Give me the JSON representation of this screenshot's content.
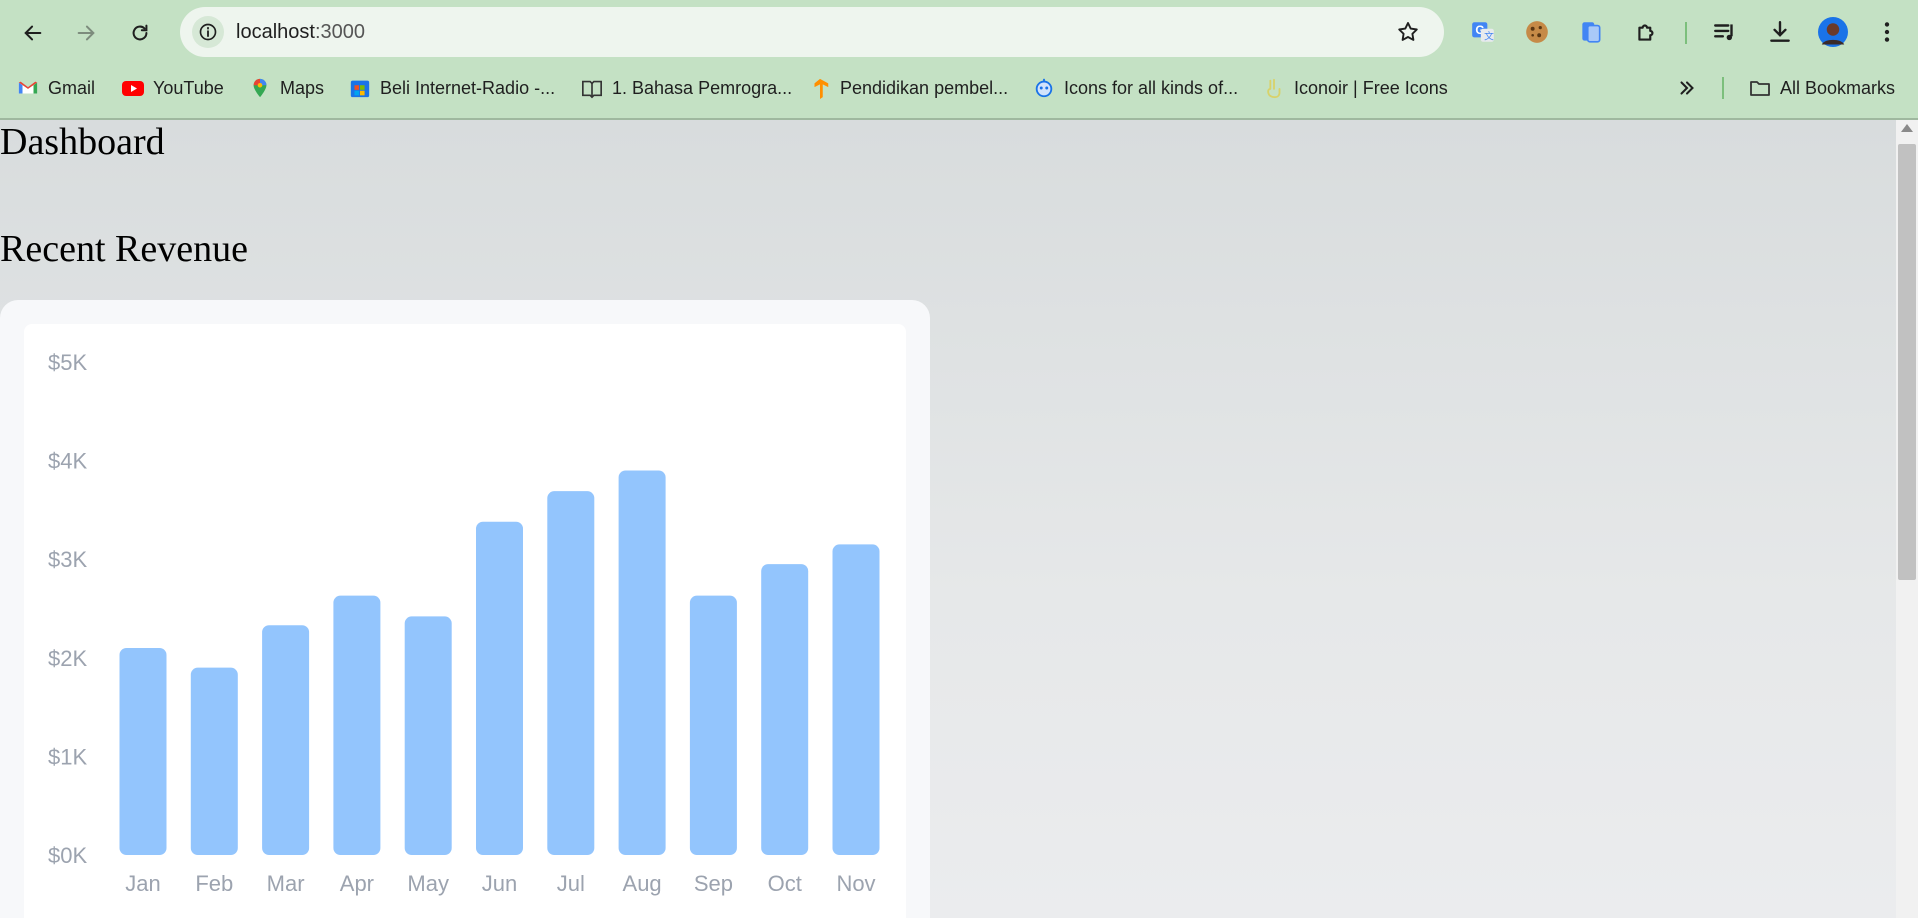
{
  "browser": {
    "url_host": "localhost",
    "url_port": ":3000",
    "bookmarks": [
      {
        "label": "Gmail",
        "icon": "gmail-icon"
      },
      {
        "label": "YouTube",
        "icon": "youtube-icon"
      },
      {
        "label": "Maps",
        "icon": "maps-icon"
      },
      {
        "label": "Beli Internet-Radio -...",
        "icon": "store-icon"
      },
      {
        "label": "1. Bahasa Pemrogra...",
        "icon": "book-icon"
      },
      {
        "label": "Pendidikan pembel...",
        "icon": "tensorflow-icon"
      },
      {
        "label": "Icons for all kinds of...",
        "icon": "bot-icon"
      },
      {
        "label": "Iconoir | Free Icons",
        "icon": "hand-peace-icon"
      }
    ],
    "all_bookmarks_label": "All Bookmarks"
  },
  "page": {
    "title": "Dashboard",
    "section_title": "Recent Revenue"
  },
  "chart_data": {
    "type": "bar",
    "categories": [
      "Jan",
      "Feb",
      "Mar",
      "Apr",
      "May",
      "Jun",
      "Jul",
      "Aug",
      "Sep",
      "Oct",
      "Nov"
    ],
    "values": [
      2100,
      1900,
      2330,
      2630,
      2420,
      3380,
      3690,
      3900,
      2630,
      2950,
      3150
    ],
    "ylim": [
      0,
      5000
    ],
    "y_ticks": [
      "$0K",
      "$1K",
      "$2K",
      "$3K",
      "$4K",
      "$5K"
    ],
    "bar_color": "#93c5fd",
    "grid": false
  }
}
